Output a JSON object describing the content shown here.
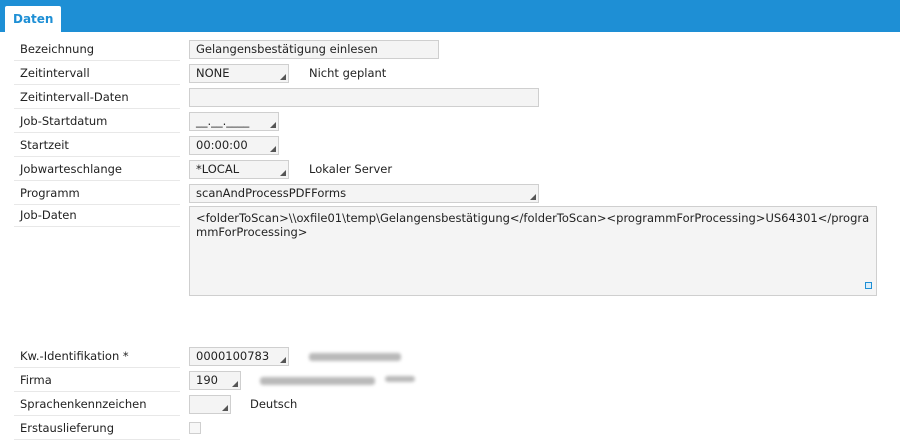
{
  "tab": {
    "label": "Daten"
  },
  "form": {
    "bezeichnung": {
      "label": "Bezeichnung",
      "value": "Gelangensbestätigung einlesen"
    },
    "zeitintervall": {
      "label": "Zeitintervall",
      "value": "NONE",
      "info": "Nicht geplant"
    },
    "zeitintervall_daten": {
      "label": "Zeitintervall-Daten",
      "value": ""
    },
    "job_startdatum": {
      "label": "Job-Startdatum",
      "value": "__.__.____"
    },
    "startzeit": {
      "label": "Startzeit",
      "value": "00:00:00"
    },
    "jobwarteschlange": {
      "label": "Jobwarteschlange",
      "value": "*LOCAL",
      "info": "Lokaler Server"
    },
    "programm": {
      "label": "Programm",
      "value": "scanAndProcessPDFForms"
    },
    "job_daten": {
      "label": "Job-Daten",
      "value": "<folderToScan>\\\\oxfile01\\temp\\Gelangensbestätigung</folderToScan><programmForProcessing>US64301</programmForProcessing>"
    },
    "kw_identifikation": {
      "label": "Kw.-Identifikation *",
      "value": "0000100783"
    },
    "firma": {
      "label": "Firma",
      "value": "190"
    },
    "sprachenkennzeichen": {
      "label": "Sprachenkennzeichen",
      "value": "",
      "info": "Deutsch"
    },
    "erstauslieferung": {
      "label": "Erstauslieferung",
      "checked": false
    }
  },
  "colors": {
    "accent": "#1e8fd5",
    "field_bg": "#f4f4f4",
    "field_border": "#cfcfcf"
  }
}
